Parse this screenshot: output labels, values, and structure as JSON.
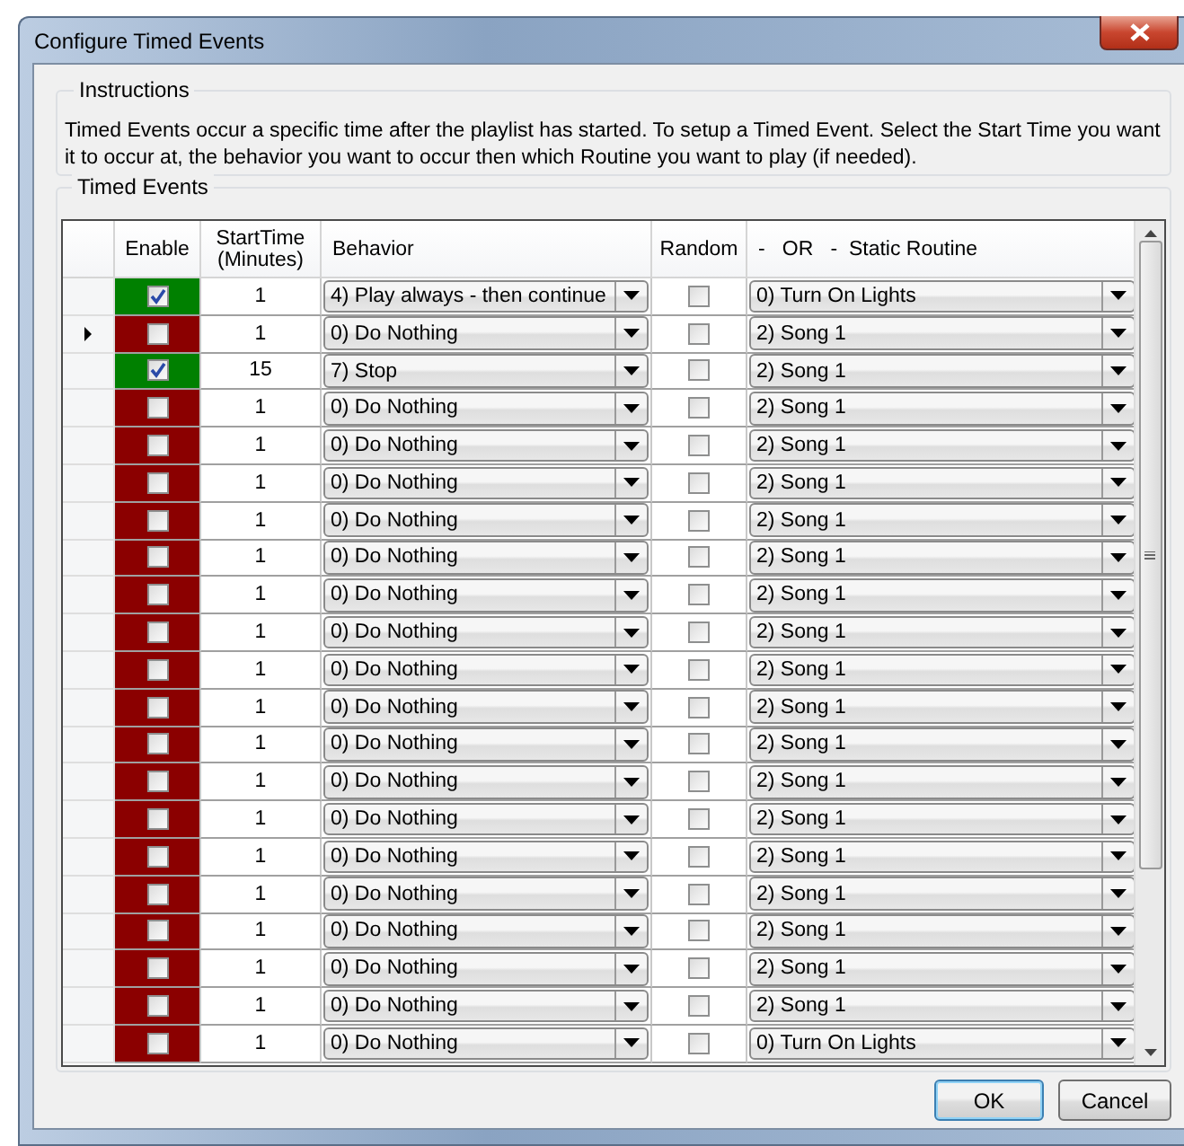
{
  "window": {
    "title": "Configure Timed Events"
  },
  "instructions": {
    "title": "Instructions",
    "text": "Timed Events occur a specific time after the playlist has started. To setup a Timed Event. Select the Start Time you want it to occur at, the behavior you want to occur then which Routine you want to play (if needed)."
  },
  "timed_events": {
    "title": "Timed Events",
    "columns": [
      "Enable",
      "StartTime\n(Minutes)",
      "Behavior",
      "Random",
      "-   OR   -  Static Routine"
    ],
    "rows": [
      {
        "current": false,
        "enabled": true,
        "start": "1",
        "behavior": "4) Play always - then continue",
        "random": false,
        "routine": "0) Turn On Lights"
      },
      {
        "current": true,
        "enabled": false,
        "start": "1",
        "behavior": "0) Do Nothing",
        "random": false,
        "routine": "2) Song 1"
      },
      {
        "current": false,
        "enabled": true,
        "start": "15",
        "behavior": "7) Stop",
        "random": false,
        "routine": "2) Song 1"
      },
      {
        "current": false,
        "enabled": false,
        "start": "1",
        "behavior": "0) Do Nothing",
        "random": false,
        "routine": "2) Song 1"
      },
      {
        "current": false,
        "enabled": false,
        "start": "1",
        "behavior": "0) Do Nothing",
        "random": false,
        "routine": "2) Song 1"
      },
      {
        "current": false,
        "enabled": false,
        "start": "1",
        "behavior": "0) Do Nothing",
        "random": false,
        "routine": "2) Song 1"
      },
      {
        "current": false,
        "enabled": false,
        "start": "1",
        "behavior": "0) Do Nothing",
        "random": false,
        "routine": "2) Song 1"
      },
      {
        "current": false,
        "enabled": false,
        "start": "1",
        "behavior": "0) Do Nothing",
        "random": false,
        "routine": "2) Song 1"
      },
      {
        "current": false,
        "enabled": false,
        "start": "1",
        "behavior": "0) Do Nothing",
        "random": false,
        "routine": "2) Song 1"
      },
      {
        "current": false,
        "enabled": false,
        "start": "1",
        "behavior": "0) Do Nothing",
        "random": false,
        "routine": "2) Song 1"
      },
      {
        "current": false,
        "enabled": false,
        "start": "1",
        "behavior": "0) Do Nothing",
        "random": false,
        "routine": "2) Song 1"
      },
      {
        "current": false,
        "enabled": false,
        "start": "1",
        "behavior": "0) Do Nothing",
        "random": false,
        "routine": "2) Song 1"
      },
      {
        "current": false,
        "enabled": false,
        "start": "1",
        "behavior": "0) Do Nothing",
        "random": false,
        "routine": "2) Song 1"
      },
      {
        "current": false,
        "enabled": false,
        "start": "1",
        "behavior": "0) Do Nothing",
        "random": false,
        "routine": "2) Song 1"
      },
      {
        "current": false,
        "enabled": false,
        "start": "1",
        "behavior": "0) Do Nothing",
        "random": false,
        "routine": "2) Song 1"
      },
      {
        "current": false,
        "enabled": false,
        "start": "1",
        "behavior": "0) Do Nothing",
        "random": false,
        "routine": "2) Song 1"
      },
      {
        "current": false,
        "enabled": false,
        "start": "1",
        "behavior": "0) Do Nothing",
        "random": false,
        "routine": "2) Song 1"
      },
      {
        "current": false,
        "enabled": false,
        "start": "1",
        "behavior": "0) Do Nothing",
        "random": false,
        "routine": "2) Song 1"
      },
      {
        "current": false,
        "enabled": false,
        "start": "1",
        "behavior": "0) Do Nothing",
        "random": false,
        "routine": "2) Song 1"
      },
      {
        "current": false,
        "enabled": false,
        "start": "1",
        "behavior": "0) Do Nothing",
        "random": false,
        "routine": "2) Song 1"
      },
      {
        "current": false,
        "enabled": false,
        "start": "1",
        "behavior": "0) Do Nothing",
        "random": false,
        "routine": "0) Turn On Lights"
      }
    ]
  },
  "buttons": [
    {
      "label": "OK",
      "default": true
    },
    {
      "label": "Cancel",
      "default": false
    }
  ]
}
